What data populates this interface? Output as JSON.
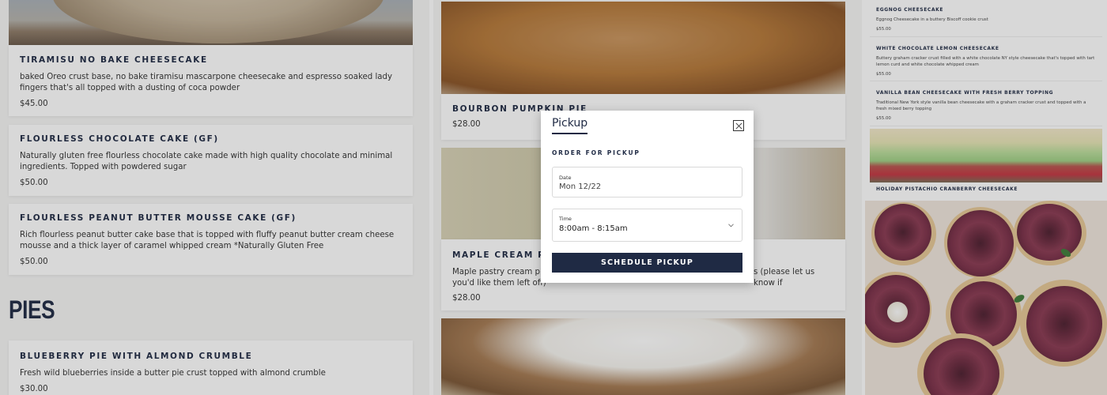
{
  "left_column": {
    "items": [
      {
        "name": "TIRAMISU NO BAKE CHEESECAKE",
        "description": "baked Oreo crust base, no bake tiramisu mascarpone cheesecake and espresso soaked lady fingers that's all topped with a dusting of coca powder",
        "price": "$45.00"
      },
      {
        "name": "FLOURLESS CHOCOLATE CAKE (GF)",
        "description": "Naturally gluten free flourless chocolate cake made with high quality chocolate and minimal ingredients. Topped with powdered sugar",
        "price": "$50.00"
      },
      {
        "name": "FLOURLESS PEANUT BUTTER MOUSSE CAKE (GF)",
        "description": "Rich flourless peanut butter cake base that is topped with fluffy peanut butter cream cheese mousse and a thick layer of caramel whipped cream *Naturally Gluten Free",
        "price": "$50.00"
      }
    ],
    "section_heading": "PIES",
    "pie_items": [
      {
        "name": "BLUEBERRY PIE WITH ALMOND CRUMBLE",
        "description": "Fresh wild blueberries inside a butter pie crust topped with almond crumble",
        "price": "$30.00"
      }
    ]
  },
  "middle_column": {
    "items": [
      {
        "name": "BOURBON PUMPKIN PIE",
        "price": "$28.00"
      },
      {
        "name": "MAPLE CREAM PIE",
        "description_start": "Maple pastry cream pie",
        "description_end": "s (please let us know if",
        "description_line2": "you'd like them left off)",
        "price": "$28.00"
      }
    ]
  },
  "right_column": {
    "items": [
      {
        "name": "EGGNOG CHEESECAKE",
        "description": "Eggnog Cheesecake in a buttery Biscoff cookie crust",
        "price": "$55.00"
      },
      {
        "name": "WHITE CHOCOLATE LEMON CHEESECAKE",
        "description": "Buttery graham cracker crust filled with a white chocolate NY style cheesecake that's topped with tart lemon curd and white chocolate whipped cream",
        "price": "$55.00"
      },
      {
        "name": "VANILLA BEAN CHEESECAKE WITH FRESH BERRY TOPPING",
        "description": "Traditional New York style vanilla bean cheesecake with a graham cracker crust and topped with a fresh mixed berry topping",
        "price": "$55.00"
      }
    ],
    "photo_caption": "HOLIDAY PISTACHIO CRANBERRY CHEESECAKE"
  },
  "modal": {
    "title": "Pickup",
    "subtitle": "ORDER FOR PICKUP",
    "date_label": "Date",
    "date_value": "Mon 12/22",
    "time_label": "Time",
    "time_value": "8:00am - 8:15am",
    "button_label": "SCHEDULE PICKUP"
  },
  "icons": {
    "close": "close-icon",
    "chevron": "chevron-down-icon"
  },
  "colors": {
    "brand_navy": "#1f2a44",
    "overlay": "rgba(40,40,40,0.18)"
  }
}
